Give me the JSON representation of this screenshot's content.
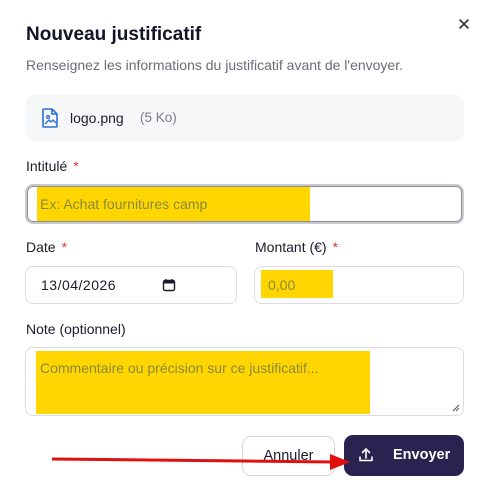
{
  "dialog": {
    "title": "Nouveau justificatif",
    "subtitle": "Renseignez les informations du justificatif avant de l'envoyer."
  },
  "file": {
    "name": "logo.png",
    "size": "(5 Ko)",
    "icon": "image-file-icon"
  },
  "fields": {
    "intitule": {
      "label": "Intitulé",
      "required_mark": "*",
      "placeholder": "Ex: Achat fournitures camp"
    },
    "date": {
      "label": "Date",
      "required_mark": "*",
      "value": "13/04/2026",
      "icon": "calendar-icon"
    },
    "montant": {
      "label": "Montant (€)",
      "required_mark": "*",
      "placeholder": "0,00"
    },
    "note": {
      "label": "Note (optionnel)",
      "placeholder": "Commentaire ou précision sur ce justificatif..."
    }
  },
  "actions": {
    "cancel_label": "Annuler",
    "send_label": "Envoyer",
    "send_icon": "upload-icon"
  },
  "colors": {
    "primary": "#2a234f",
    "required": "#e53935",
    "highlight": "#ffd600",
    "annotation_arrow": "#e01010"
  }
}
